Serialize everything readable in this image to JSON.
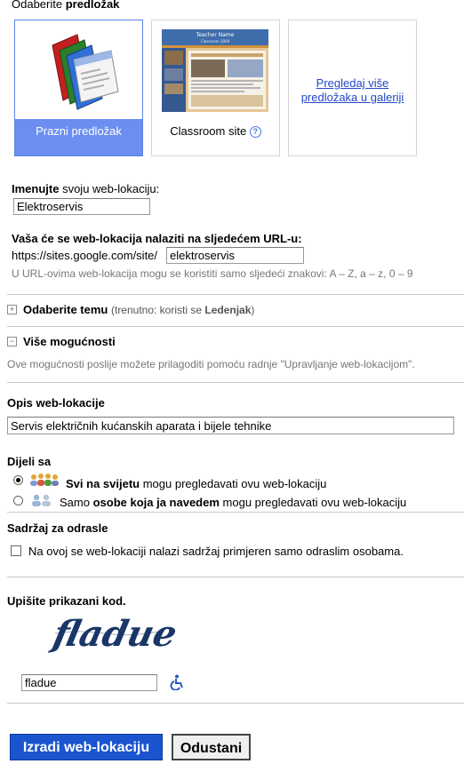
{
  "header": {
    "prefix": "Odaberite",
    "bold": "predložak"
  },
  "templates": [
    {
      "label": "Prazni predložak",
      "icon": "blank-template-icon"
    },
    {
      "label": "Classroom site",
      "icon": "classroom-thumbnail",
      "thumb_title": "Teacher Name",
      "thumb_sub": "Classroom 2009"
    },
    {
      "label": "Pregledaj više predložaka u galeriji"
    }
  ],
  "name_section": {
    "label_bold": "Imenujte",
    "label_rest": " svoju web-lokaciju:",
    "value": "Elektroservis"
  },
  "url_section": {
    "label": "Vaša će se web-lokacija nalaziti na sljedećem URL-u:",
    "prefix": "https://sites.google.com/site/",
    "value": "elektroservis",
    "hint": "U URL-ovima web-lokacija mogu se koristiti samo sljedeći znakovi: A – Z, a – z, 0 – 9"
  },
  "theme_section": {
    "title": "Odaberite temu",
    "current_prefix": "(trenutno: koristi se ",
    "current_value": "Ledenjak",
    "current_suffix": ")"
  },
  "more_section": {
    "title": "Više mogućnosti",
    "note": "Ove mogućnosti poslije možete prilagoditi pomoću radnje \"Upravljanje web-lokacijom\"."
  },
  "description": {
    "label": "Opis web-lokacije",
    "value": "Servis električnih kućanskih aparata i bijele tehnike"
  },
  "share": {
    "label": "Dijeli sa",
    "opt1_bold": "Svi na svijetu",
    "opt1_rest": " mogu pregledavati ovu web-lokaciju",
    "opt2_pre": "Samo ",
    "opt2_bold": "osobe koja ja navedem",
    "opt2_rest": " mogu pregledavati ovu web-lokaciju",
    "selected": 1
  },
  "adult": {
    "label": "Sadržaj za odrasle",
    "checkbox_label": "Na ovoj se web-lokaciji nalazi sadržaj primjeren samo odraslim osobama.",
    "checked": false
  },
  "captcha": {
    "label": "Upišite prikazani kod.",
    "image_text": "fladue",
    "value": "fladue"
  },
  "actions": {
    "create": "Izradi web-lokaciju",
    "cancel": "Odustani"
  },
  "colors": {
    "accent": "#6b8ef0",
    "link": "#2447c9",
    "primary_button": "#1a55cf"
  }
}
